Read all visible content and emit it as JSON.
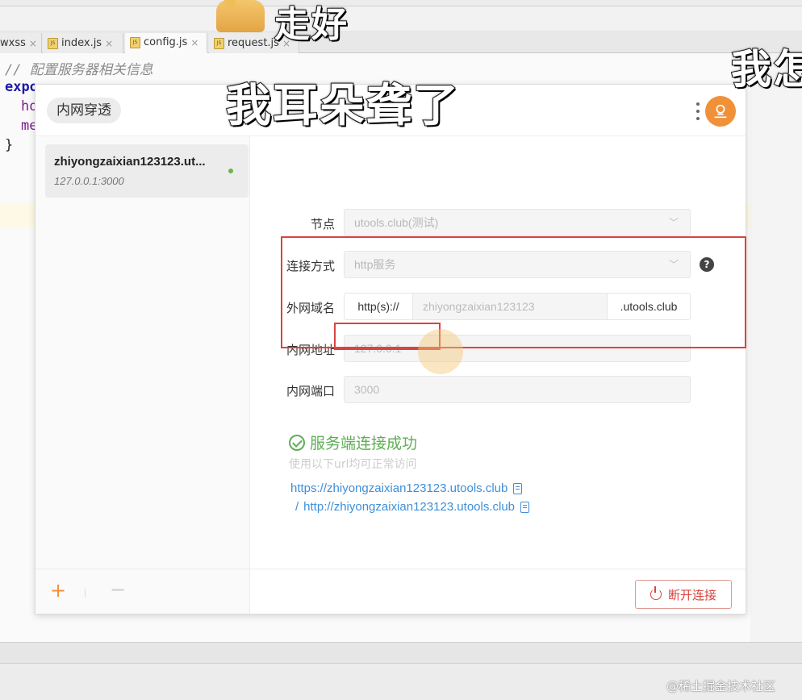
{
  "ide": {
    "tabs": [
      {
        "label": "wxss",
        "icon": "wxss-file-icon"
      },
      {
        "label": "index.js",
        "icon": "js-file-icon"
      },
      {
        "label": "config.js",
        "icon": "js-file-icon",
        "active": true
      },
      {
        "label": "request.js",
        "icon": "js-file-icon"
      }
    ],
    "close_glyph": "×",
    "code": {
      "comment": "// 配置服务器相关信息",
      "line2": "expo",
      "line3": "ho",
      "line4": "me",
      "line5": "}"
    }
  },
  "captions": {
    "top": "走好",
    "middle": "我耳朵聋了",
    "right": "我怎"
  },
  "window": {
    "title": "内网穿透",
    "avatar_icon": "cloud-user-icon",
    "tunnels": [
      {
        "name": "zhiyongzaixian123123.ut...",
        "address": "127.0.0.1:3000",
        "status_color": "#6bb54a"
      }
    ],
    "sidebar_footer": {
      "add": "+",
      "remove": "−"
    },
    "form": {
      "node_label": "节点",
      "node_value": "utools.club(测试)",
      "conn_label": "连接方式",
      "conn_value": "http服务",
      "help": "?",
      "domain_label": "外网域名",
      "domain_prefix": "http(s)://",
      "domain_value": "zhiyongzaixian123123",
      "domain_suffix": ".utools.club",
      "addr_label": "内网地址",
      "addr_value": "127.0.0.1",
      "port_label": "内网端口",
      "port_value": "3000"
    },
    "status": {
      "success_text": "服务端连接成功",
      "hint": "使用以下url均可正常访问",
      "https_url": "https://zhiyongzaixian123123.utools.club",
      "separator": "/",
      "http_url": "http://zhiyongzaixian123123.utools.club"
    },
    "disconnect_label": "断开连接"
  },
  "watermark": "@稀土掘金技术社区",
  "colors": {
    "accent": "#f0913a",
    "success": "#5fae56",
    "link": "#3e8fd8",
    "danger": "#d9443e"
  }
}
